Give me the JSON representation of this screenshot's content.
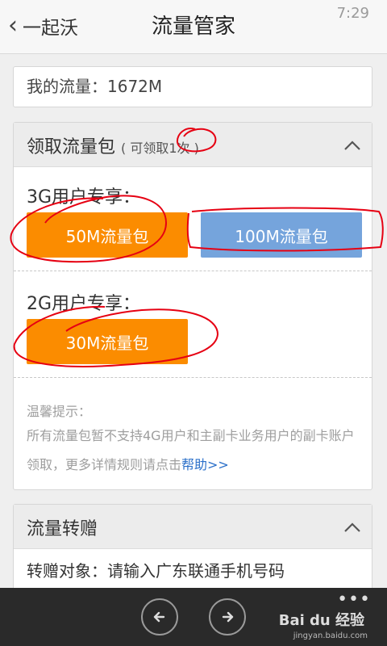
{
  "status": {
    "time": "7:29"
  },
  "header": {
    "back_label": "一起沃",
    "title": "流量管家"
  },
  "flow": {
    "total_text": "我的流量：1672M"
  },
  "receive": {
    "title": "领取流量包",
    "sub_prefix": "( 可领取",
    "sub_count": "1",
    "sub_suffix": "次 )",
    "section_3g": "3G用户专享：",
    "btn_50m": "50M流量包",
    "btn_100m": "100M流量包",
    "section_2g": "2G用户专享：",
    "btn_30m": "30M流量包",
    "tips_title": "温馨提示：",
    "tips_text": "所有流量包暂不支持4G用户和主副卡业务用户的副卡账户领取，更多详情规则请点击",
    "help_link": "帮助>>"
  },
  "transfer": {
    "title": "流量转赠",
    "target_text": "转赠对象：请输入广东联通手机号码"
  },
  "bottom": {
    "more": "•••",
    "watermark": "Bai du 经验",
    "watermark_url": "jingyan.baidu.com"
  },
  "colors": {
    "orange": "#fb8c00",
    "blue": "#75a4dc",
    "annotation_red": "#e60012",
    "link": "#2a6fc9"
  }
}
